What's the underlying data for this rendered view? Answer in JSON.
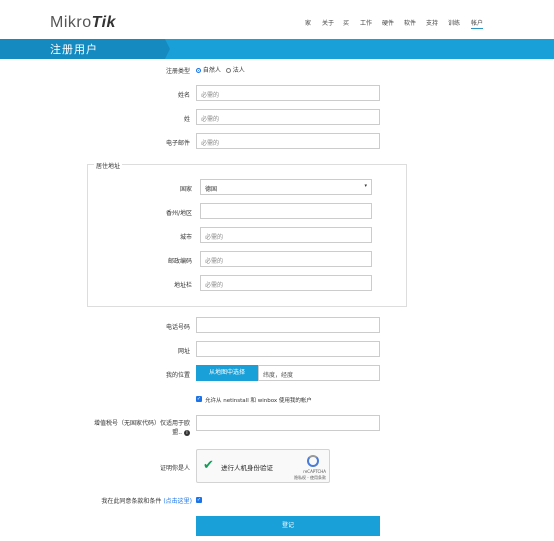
{
  "header": {
    "logo_text_a": "Mikro",
    "logo_text_b": "Tik",
    "nav": [
      "家",
      "关于",
      "买",
      "工作",
      "硬件",
      "软件",
      "支持",
      "训练",
      "帐户"
    ]
  },
  "banner": {
    "title": "注册用户"
  },
  "form": {
    "reg_type_label": "注册类型",
    "reg_type_options": [
      "自然人",
      "法人"
    ],
    "name_label": "姓名",
    "name_placeholder": "必需的",
    "surname_label": "姓",
    "surname_placeholder": "必需的",
    "email_label": "电子邮件",
    "email_placeholder": "必需的",
    "address_legend": "居住地址",
    "country_label": "国家",
    "country_value": "德国",
    "state_label": "香州/地区",
    "city_label": "城市",
    "city_placeholder": "必需的",
    "zip_label": "邮政编码",
    "zip_placeholder": "必需的",
    "street_label": "地址栏",
    "street_placeholder": "必需的",
    "phone_label": "电话号码",
    "url_label": "网址",
    "location_label": "我的位置",
    "location_button": "从地图中选择",
    "location_placeholder": "纬度，经度",
    "netinstall_text": "允许从 netinstall 和 winbox 使用我的帐户",
    "vat_label": "增值税号（无国家代码）仅适用于欧盟..",
    "captcha_label": "证明你是人",
    "captcha_text": "进行人机身份验证",
    "captcha_brand": "reCAPTCHA",
    "captcha_links": "隐私权 - 使用条款",
    "terms_text": "我在此同意条款和条件",
    "terms_link": "(点击这里)",
    "submit": "登记"
  },
  "colors": {
    "accent": "#1aa0d8"
  }
}
